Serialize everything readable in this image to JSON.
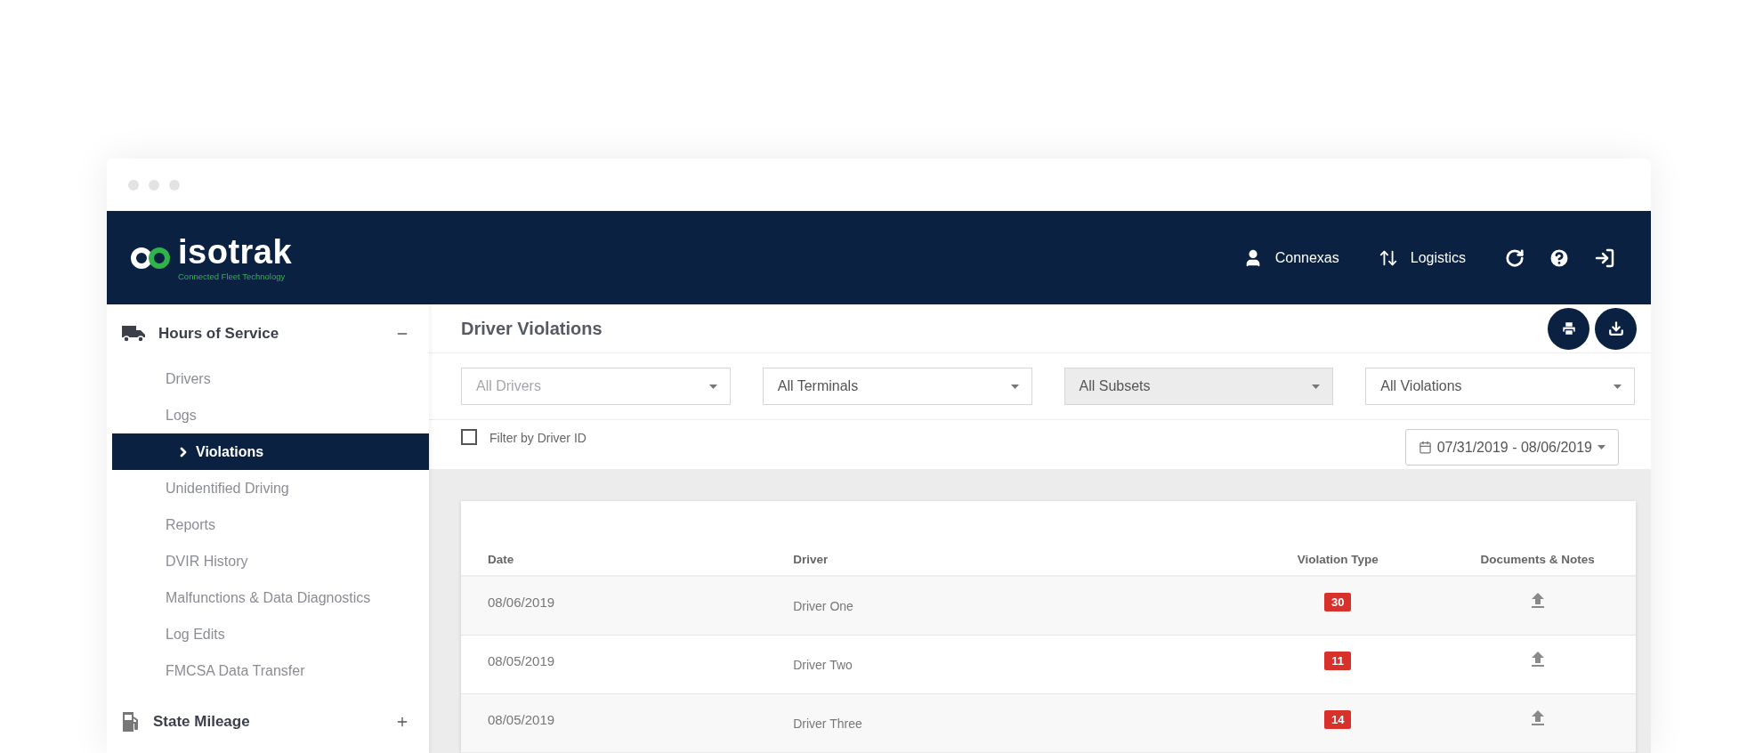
{
  "header": {
    "logo": {
      "name": "isotrak",
      "tagline": "Connected Fleet Technology"
    },
    "account": "Connexas",
    "group": "Logistics"
  },
  "sidebar": {
    "sections": [
      {
        "label": "Hours of Service",
        "expanded": true,
        "items": [
          {
            "label": "Drivers",
            "selected": false
          },
          {
            "label": "Logs",
            "selected": false
          },
          {
            "label": "Violations",
            "selected": true
          },
          {
            "label": "Unidentified Driving",
            "selected": false
          },
          {
            "label": "Reports",
            "selected": false
          },
          {
            "label": "DVIR History",
            "selected": false
          },
          {
            "label": "Malfunctions & Data Diagnostics",
            "selected": false
          },
          {
            "label": "Log Edits",
            "selected": false
          },
          {
            "label": "FMCSA Data Transfer",
            "selected": false
          }
        ]
      },
      {
        "label": "State Mileage",
        "expanded": false
      }
    ]
  },
  "page": {
    "title": "Driver Violations"
  },
  "filters": [
    {
      "placeholder": "All Drivers",
      "disabled": false
    },
    {
      "value": "All Terminals",
      "disabled": false
    },
    {
      "value": "All Subsets",
      "disabled": true
    },
    {
      "value": "All Violations",
      "disabled": false
    }
  ],
  "driver_id_filter": {
    "label": "Filter by Driver ID",
    "checked": false
  },
  "date_range": "07/31/2019 - 08/06/2019",
  "table": {
    "columns": [
      "Date",
      "Driver",
      "Violation Type",
      "Documents & Notes"
    ],
    "rows": [
      {
        "date": "08/06/2019",
        "driver": "Driver One",
        "violation": "30"
      },
      {
        "date": "08/05/2019",
        "driver": "Driver Two",
        "violation": "11"
      },
      {
        "date": "08/05/2019",
        "driver": "Driver Three",
        "violation": "14"
      }
    ]
  }
}
